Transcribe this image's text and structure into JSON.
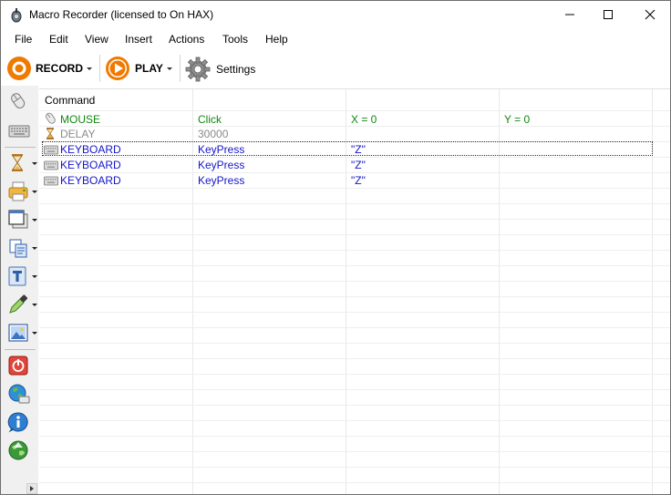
{
  "window": {
    "title": "Macro Recorder (licensed to On HAX)"
  },
  "menu": [
    "File",
    "Edit",
    "View",
    "Insert",
    "Actions",
    "Tools",
    "Help"
  ],
  "toolbar": {
    "record_label": "RECORD",
    "play_label": "PLAY",
    "settings_label": "Settings"
  },
  "palette": [
    {
      "icon": "mouse-icon"
    },
    {
      "icon": "keyboard-icon"
    },
    {
      "icon": "hourglass-icon"
    },
    {
      "icon": "printer-icon"
    },
    {
      "icon": "window-icon"
    },
    {
      "icon": "clipboard-icon"
    },
    {
      "icon": "text-icon"
    },
    {
      "icon": "eyedropper-icon"
    },
    {
      "icon": "image-icon"
    },
    {
      "icon": "stop-icon"
    },
    {
      "icon": "web-icon"
    },
    {
      "icon": "info-icon"
    },
    {
      "icon": "globe-icon"
    }
  ],
  "grid": {
    "columns": [
      "Command",
      "",
      "",
      ""
    ],
    "rows": [
      {
        "type": "mouse",
        "color": "#118811",
        "cells": [
          "MOUSE",
          "Click",
          "X = 0",
          "Y = 0"
        ]
      },
      {
        "type": "delay",
        "color": "#8a8a8a",
        "cells": [
          "DELAY",
          "30000",
          "",
          ""
        ]
      },
      {
        "type": "keyboard",
        "color": "#1515c8",
        "cells": [
          "KEYBOARD",
          "KeyPress",
          "\"Z\"",
          ""
        ]
      },
      {
        "type": "keyboard",
        "color": "#1515c8",
        "cells": [
          "KEYBOARD",
          "KeyPress",
          "\"Z\"",
          ""
        ]
      },
      {
        "type": "keyboard",
        "color": "#1515c8",
        "cells": [
          "KEYBOARD",
          "KeyPress",
          "\"Z\"",
          ""
        ]
      }
    ]
  },
  "colors": {
    "record_orange": "#f07a00",
    "mouse_green": "#118811",
    "delay_gray": "#8a8a8a",
    "keyboard_blue": "#1515c8"
  }
}
